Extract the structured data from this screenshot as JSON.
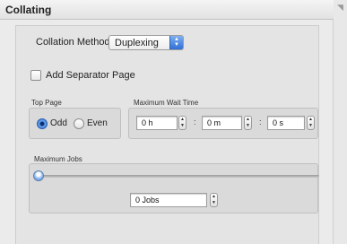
{
  "panel": {
    "title": "Collating"
  },
  "collation": {
    "label": "Collation Method:",
    "selected": "Duplexing"
  },
  "separator": {
    "label": "Add Separator Page",
    "checked": false
  },
  "top_page": {
    "label": "Top Page",
    "options": [
      {
        "label": "Odd",
        "selected": true
      },
      {
        "label": "Even",
        "selected": false
      }
    ]
  },
  "wait_time": {
    "label": "Maximum Wait Time",
    "hours": "0 h",
    "minutes": "0 m",
    "seconds": "0 s",
    "separator": ":"
  },
  "max_jobs": {
    "label": "Maximum Jobs",
    "value": "0 Jobs",
    "slider_fraction": 0
  },
  "colors": {
    "accent": "#2f6fd6",
    "panel_bg": "#ebebeb"
  },
  "icons": {
    "popup_arrows": "up-down-arrows-icon",
    "stepper": "stepper-arrows-icon",
    "corner": "resize-corner-icon"
  }
}
